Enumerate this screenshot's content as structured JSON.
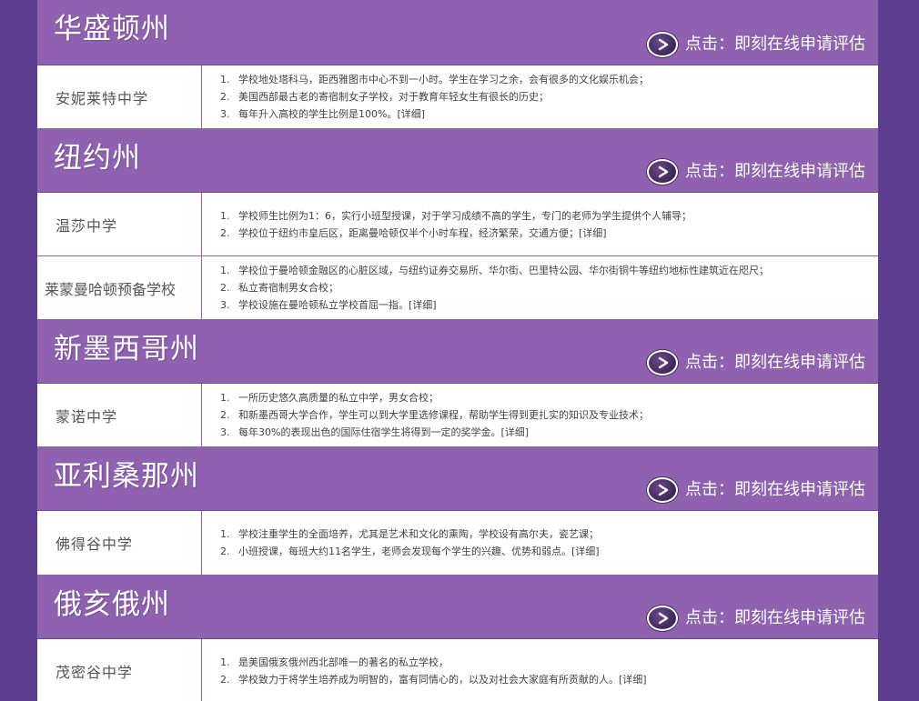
{
  "apply_text": "点击：即刻在线申请评估",
  "detail_label": "[详细]",
  "states": [
    {
      "name": "华盛顿州",
      "schools": [
        {
          "name": "安妮莱特中学",
          "points": [
            "学校地处塔科马，距西雅图市中心不到一小时。学生在学习之余，会有很多的文化娱乐机会；",
            "美国西部最古老的寄宿制女子学校，对于教育年轻女生有很长的历史；",
            "每年升入高校的学生比例是100%。"
          ]
        }
      ]
    },
    {
      "name": "纽约州",
      "schools": [
        {
          "name": "温莎中学",
          "points": [
            "学校师生比例为1：6，实行小班型授课，对于学习成绩不高的学生，专门的老师为学生提供个人辅导；",
            "学校位于纽约市皇后区，距离曼哈顿仅半个小时车程，经济繁荣，交通方便；"
          ]
        },
        {
          "name": "莱蒙曼哈顿预备学校",
          "points": [
            "学校位于曼哈顿金融区的心脏区域，与纽约证券交易所、华尔街、巴里特公园、华尔街铜牛等纽约地标性建筑近在咫尺；",
            "私立寄宿制男女合校；",
            "学校设施在曼哈顿私立学校首屈一指。"
          ]
        }
      ]
    },
    {
      "name": "新墨西哥州",
      "schools": [
        {
          "name": "蒙诺中学",
          "points": [
            "一所历史悠久高质量的私立中学，男女合校；",
            "和新墨西哥大学合作，学生可以到大学里选修课程，帮助学生得到更扎实的知识及专业技术；",
            "每年30%的表现出色的国际住宿学生将得到一定的奖学金。"
          ]
        }
      ]
    },
    {
      "name": "亚利桑那州",
      "schools": [
        {
          "name": "佛得谷中学",
          "points": [
            "学校注重学生的全面培养，尤其是艺术和文化的熏陶，学校设有高尔夫，瓷艺课；",
            "小班授课，每班大约11名学生，老师会发现每个学生的兴趣、优势和弱点。"
          ]
        }
      ]
    },
    {
      "name": "俄亥俄州",
      "schools": [
        {
          "name": "茂密谷中学",
          "points": [
            "是美国俄亥俄州西北部唯一的著名的私立学校，",
            "学校致力于将学生培养成为明智的，富有同情心的，以及对社会大家庭有所贡献的人。"
          ]
        }
      ]
    }
  ]
}
